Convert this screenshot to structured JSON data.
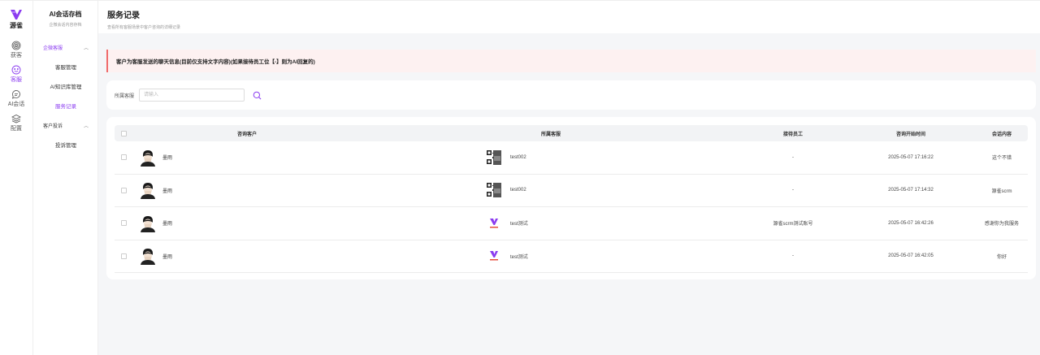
{
  "brand": {
    "name": "源雀"
  },
  "rail": {
    "items": [
      {
        "label": "获客",
        "icon": "fingerprint-icon"
      },
      {
        "label": "客服",
        "icon": "smile-icon"
      },
      {
        "label": "AI会话",
        "icon": "chat-icon"
      },
      {
        "label": "配置",
        "icon": "layers-icon"
      }
    ],
    "active_color": "#8b3cf0"
  },
  "menu": {
    "title": "AI会话存档",
    "subtitle": "企微会话内容存档",
    "groups": [
      {
        "label": "企微客服",
        "items": [
          "客服管理",
          "AI知识库管理",
          "服务记录"
        ]
      },
      {
        "label": "客户投诉",
        "items": [
          "投诉管理"
        ]
      }
    ]
  },
  "page": {
    "title": "服务记录",
    "description": "查看所有客服场景中客户咨询的详细记录"
  },
  "alert": {
    "text": "客户为客服发送的聊天信息(目前仅支持文字内容)(如果接待员工位【-】则为AI回复的)",
    "accent": "#f06b6b"
  },
  "filter": {
    "label": "所属客服",
    "placeholder": "请输入",
    "value": ""
  },
  "table": {
    "headers": [
      "咨询客户",
      "所属客服",
      "接待员工",
      "咨询开始时间",
      "会话内容"
    ],
    "rows": [
      {
        "customer": "墨雨",
        "agent": "test002",
        "agent_avatar": "qr",
        "staff": "-",
        "time": "2025-05-07 17:16:22",
        "content": "这个不错"
      },
      {
        "customer": "墨雨",
        "agent": "test002",
        "agent_avatar": "qr",
        "staff": "-",
        "time": "2025-05-07 17:14:32",
        "content": "源雀scrm"
      },
      {
        "customer": "墨雨",
        "agent": "test测试",
        "agent_avatar": "logo",
        "staff": "源雀scrm测试账号",
        "time": "2025-05-07 16:42:26",
        "content": "感谢你为我服务"
      },
      {
        "customer": "墨雨",
        "agent": "test测试",
        "agent_avatar": "logo",
        "staff": "-",
        "time": "2025-05-07 16:42:05",
        "content": "你好"
      }
    ]
  }
}
